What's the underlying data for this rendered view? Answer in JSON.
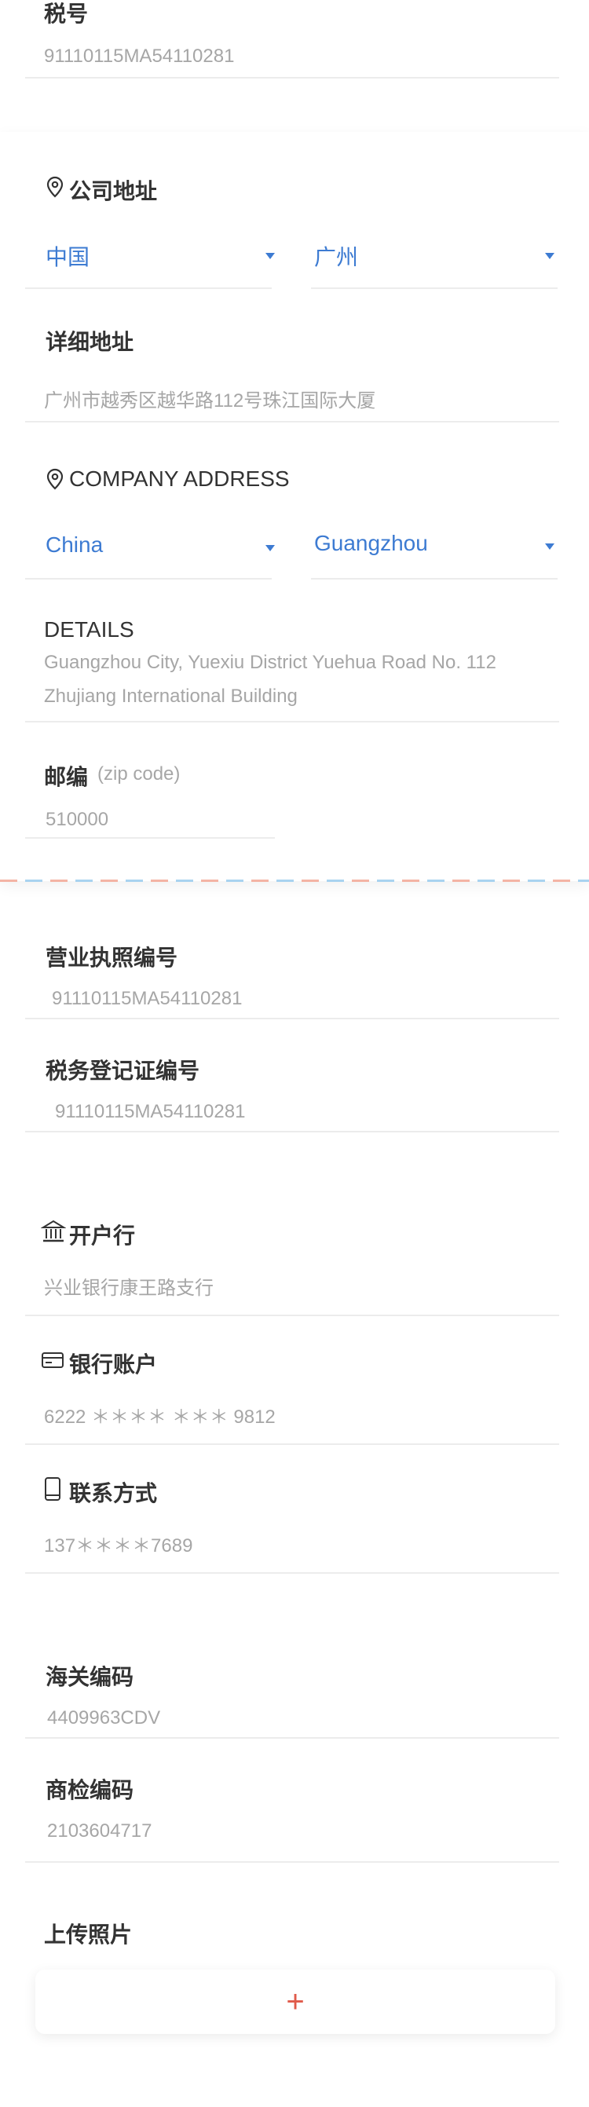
{
  "tax": {
    "label": "税号",
    "value": "91110115MA54110281"
  },
  "company_address_cn": {
    "title": "公司地址",
    "country": "中国",
    "city": "广州",
    "detail_label": "详细地址",
    "detail_value": "广州市越秀区越华路112号珠江国际大厦"
  },
  "company_address_en": {
    "title": "COMPANY ADDRESS",
    "country": "China",
    "city": "Guangzhou",
    "detail_label": "DETAILS",
    "detail_line1": "Guangzhou City, Yuexiu District Yuehua Road No. 112",
    "detail_line2": "Zhujiang International Building"
  },
  "postal": {
    "label": "邮编",
    "hint": "(zip code)",
    "value": "510000"
  },
  "business_license": {
    "label": "营业执照编号",
    "value": "91110115MA54110281"
  },
  "tax_registration": {
    "label": "税务登记证编号",
    "value": "91110115MA54110281"
  },
  "bank": {
    "label": "开户行",
    "value": "兴业银行康王路支行",
    "icon": "bank-icon"
  },
  "bank_account": {
    "label": "银行账户",
    "value": "6222 ＊＊＊＊ ＊＊＊ 9812",
    "icon": "card-icon"
  },
  "contact": {
    "label": "联系方式",
    "value": "137＊＊＊＊7689",
    "icon": "phone-icon"
  },
  "customs": {
    "label": "海关编码",
    "value": "4409963CDV"
  },
  "inspection": {
    "label": "商检编码",
    "value": "2103604717"
  },
  "photo": {
    "label": "上传照片",
    "add_symbol": "+"
  },
  "colors": {
    "accent": "#3d7bd2",
    "plus": "#e05a4a",
    "dash_orange": "#f4b4a5",
    "dash_blue": "#a9d3f0"
  }
}
